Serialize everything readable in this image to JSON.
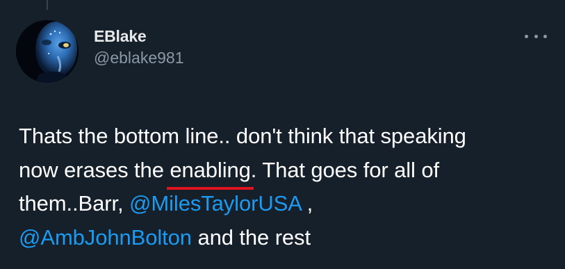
{
  "author": {
    "display_name": "EBlake",
    "handle": "@eblake981",
    "avatar_icon": "avatar-blue-face"
  },
  "more_icon": "more-horizontal-icon",
  "tweet": {
    "line1": "Thats the bottom line.. don't think that speaking",
    "line2_prefix": "now erases the ",
    "line2_highlight": "enabling",
    "line2_suffix": ". That goes for all of",
    "line3_prefix": "them..Barr, ",
    "mention1": "@MilesTaylorUSA",
    "line3_suffix": " ,",
    "mention2": "@AmbJohnBolton",
    "line4_suffix": " and the rest"
  },
  "colors": {
    "background": "#15202b",
    "text": "#ffffff",
    "secondary_text": "#8b98a5",
    "mention": "#1d9bf0",
    "underline": "#e0141f"
  }
}
